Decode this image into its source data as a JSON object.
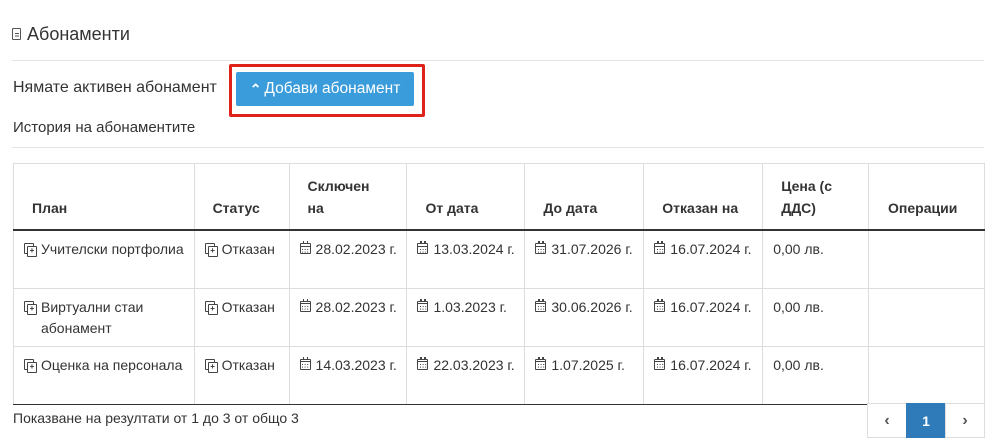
{
  "page": {
    "title": "Абонаменти",
    "no_subscription_text": "Нямате активен абонамент",
    "add_button_label": "Добави абонамент",
    "history_title": "История на абонаментите"
  },
  "table": {
    "columns": [
      "План",
      "Статус",
      "Сключен на",
      "От дата",
      "До дата",
      "Отказан на",
      "Цена (с ДДС)",
      "Операции"
    ],
    "rows": [
      {
        "plan": "Учителски портфолиа",
        "status": "Отказан",
        "signed": "28.02.2023 г.",
        "from": "13.03.2024 г.",
        "to": "31.07.2026 г.",
        "cancelled": "16.07.2024 г.",
        "price": "0,00 лв.",
        "operations": ""
      },
      {
        "plan": "Виртуални стаи абонамент",
        "status": "Отказан",
        "signed": "28.02.2023 г.",
        "from": "1.03.2023 г.",
        "to": "30.06.2026 г.",
        "cancelled": "16.07.2024 г.",
        "price": "0,00 лв.",
        "operations": ""
      },
      {
        "plan": "Оценка на персонала",
        "status": "Отказан",
        "signed": "14.03.2023 г.",
        "from": "22.03.2023 г.",
        "to": "1.07.2025 г.",
        "cancelled": "16.07.2024 г.",
        "price": "0,00 лв.",
        "operations": ""
      }
    ]
  },
  "pagination": {
    "summary": "Показване на резултати от 1 до 3 от общо 3",
    "prev": "‹",
    "current_page": "1",
    "next": "›"
  },
  "icons": {
    "title": "document-icon",
    "add": "double-chevron-up-icon",
    "plan": "copy-icon",
    "status": "copy-icon",
    "date": "calendar-icon"
  },
  "colors": {
    "button": "#3b9cdc",
    "highlight": "#e0231a",
    "active_page": "#2f7ab8"
  }
}
